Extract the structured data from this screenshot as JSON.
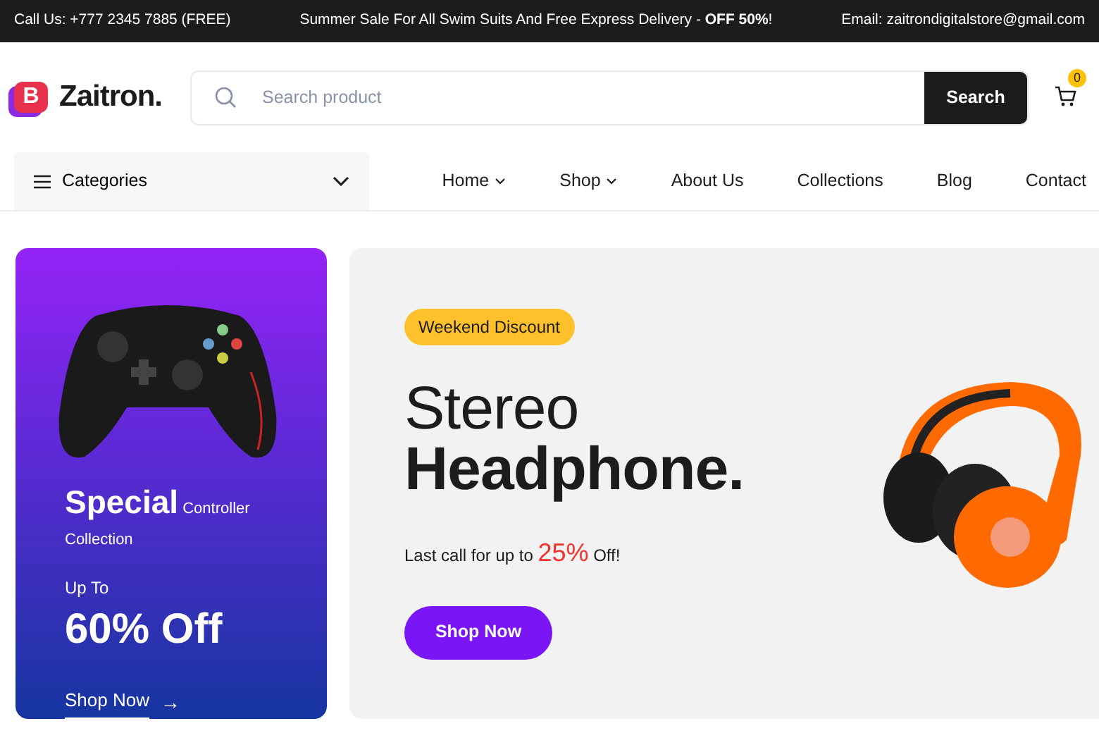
{
  "top_bar": {
    "phone": "Call Us: +777 2345 7885 (FREE)",
    "promo": "Summer Sale For All Swim Suits And Free Express Delivery - **OFF 50%**!",
    "email": "Email: zaitrondigitalstore@gmail.com"
  },
  "header": {
    "logo_mark": "B",
    "logo_text": "Zaitron.",
    "search": {
      "placeholder": "Search product",
      "button": "Search"
    },
    "cart_count": "0"
  },
  "categories": {
    "label": "Categories",
    "expanded": false
  },
  "nav": [
    {
      "label": "Home",
      "has_menu": true
    },
    {
      "label": "Shop",
      "has_menu": true
    },
    {
      "label": "About Us",
      "has_menu": false
    },
    {
      "label": "Collections",
      "has_menu": false
    },
    {
      "label": "Blog",
      "has_menu": false
    },
    {
      "label": "Contact",
      "has_menu": false
    }
  ],
  "side_promo": {
    "title_big": "Special",
    "title_small": "Controller Collection",
    "subtitle": "Up To",
    "offer": "60% Off",
    "link": "Shop Now",
    "link_arrow": "→"
  },
  "hero": {
    "badge": "Weekend Discount",
    "title_line_1": "Stereo",
    "title_line_2": "Headphone.",
    "text_before": "Last call for up to",
    "highlight": "25%",
    "text_after": "Off!",
    "button": "Shop Now"
  }
}
